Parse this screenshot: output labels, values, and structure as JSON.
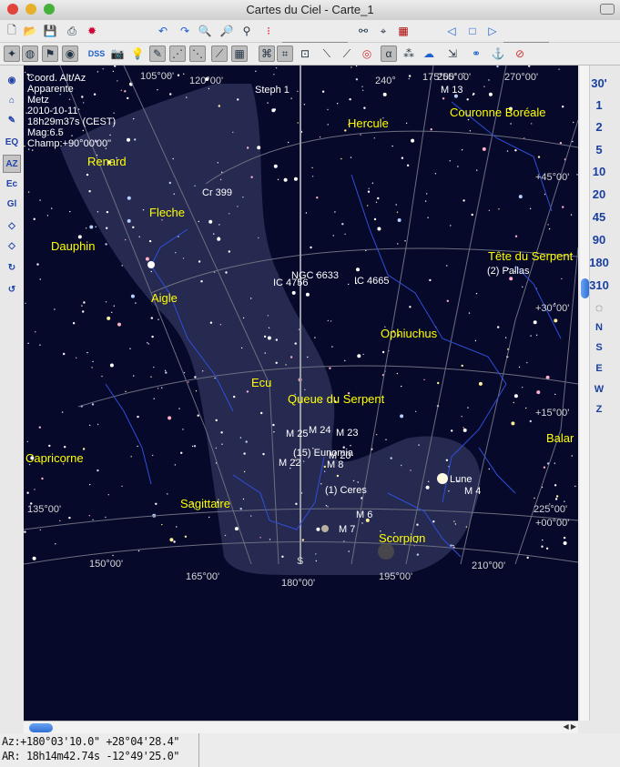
{
  "window": {
    "title": "Cartes du Ciel - Carte_1"
  },
  "toolbar": {
    "field_combo_value": "",
    "chart_number": "1",
    "dss_label": "DSS",
    "alpha_label": "α"
  },
  "left_tools": [
    "EQ",
    "AZ",
    "Ec",
    "Gl"
  ],
  "fov_buttons": [
    "30'",
    "1",
    "2",
    "5",
    "10",
    "20",
    "45",
    "90",
    "180",
    "310"
  ],
  "direction_buttons": [
    "N",
    "S",
    "E",
    "W",
    "Z"
  ],
  "chart_info": {
    "lines": [
      "Coord. Alt/Az",
      "Apparente",
      "Metz",
      "2010-10-11",
      "18h29m37s (CEST)",
      "Mag:6.5",
      "Champ:+90°00'00\""
    ]
  },
  "chart_labels": {
    "constellations": [
      "Renard",
      "Fleche",
      "Dauphin",
      "Aigle",
      "Hercule",
      "Couronne Boréale",
      "Tête du Serpent",
      "Ophiuchus",
      "Ecu",
      "Queue du Serpent",
      "Capricorne",
      "Sagittaire",
      "Scorpion",
      "Balar"
    ],
    "objects": [
      "Steph 1",
      "Cr 399",
      "M 13",
      "NGC 6633",
      "IC 4756",
      "IC 4665",
      "(2) Pallas",
      "M 25",
      "M 24",
      "M 23",
      "M 22",
      "(15) Eunomia",
      "M 8",
      "M 20",
      "(1) Ceres",
      "M 6",
      "M 7",
      "M 4",
      "Lune"
    ],
    "azimuth_ticks": [
      "105°00'",
      "120°00'",
      "240°",
      "175°00'",
      "255°00'",
      "270°00'",
      "150°00'",
      "165°00'",
      "180°00'",
      "195°00'",
      "210°00'",
      "225°00'",
      "135°00'"
    ],
    "altitude_ticks": [
      "+45°00'",
      "+30°00'",
      "+15°00'",
      "+00°00'"
    ],
    "horizon_point": "S"
  },
  "status": {
    "az": "Az:+180°03'10.0\" +28°04'28.4\"",
    "ar": "AR: 18h14m42.74s -12°49'25.0\""
  },
  "colors": {
    "sky": "#06092a",
    "milky_way": "#2a2f55",
    "constellation_label": "#ffff00",
    "grid": "#6c6f7f",
    "constellation_line": "#2f4fd8"
  }
}
